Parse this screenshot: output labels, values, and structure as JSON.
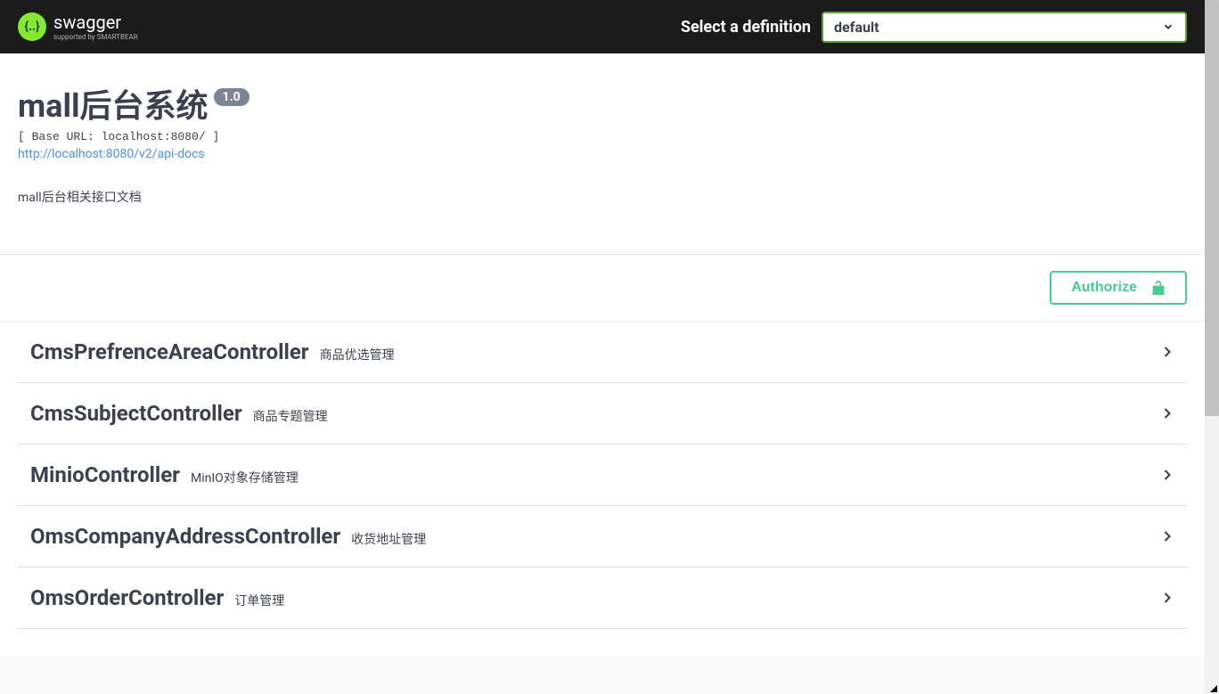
{
  "topbar": {
    "logo_name": "swagger",
    "logo_sub": "supported by SMARTBEAR",
    "definition_label": "Select a definition",
    "selected_definition": "default"
  },
  "info": {
    "title": "mall后台系统",
    "version": "1.0",
    "base_url_text": "[ Base URL: localhost:8080/ ]",
    "api_docs_url": "http://localhost:8080/v2/api-docs",
    "description": "mall后台相关接口文档"
  },
  "auth": {
    "authorize_label": "Authorize"
  },
  "tags": [
    {
      "name": "CmsPrefrenceAreaController",
      "desc": "商品优选管理"
    },
    {
      "name": "CmsSubjectController",
      "desc": "商品专题管理"
    },
    {
      "name": "MinioController",
      "desc": "MinIO对象存储管理"
    },
    {
      "name": "OmsCompanyAddressController",
      "desc": "收货地址管理"
    },
    {
      "name": "OmsOrderController",
      "desc": "订单管理"
    }
  ]
}
